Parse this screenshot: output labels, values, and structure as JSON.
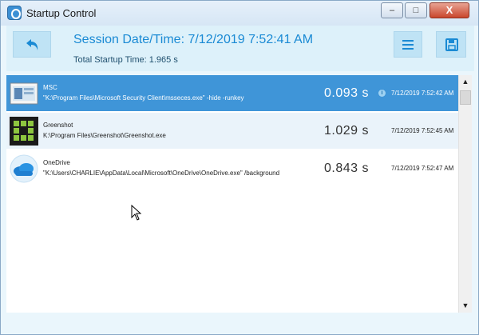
{
  "window": {
    "title": "Startup Control",
    "icon": "startup-control-app-icon",
    "controls": {
      "minimize": "–",
      "maximize": "□",
      "close": "X"
    }
  },
  "header": {
    "session_label": "Session Date/Time: 7/12/2019 7:52:41 AM",
    "total_label": "Total Startup Time: 1.965 s",
    "back_icon": "undo-arrow-icon",
    "menu_icon": "hamburger-menu-icon",
    "save_icon": "floppy-disk-icon",
    "accent_color": "#1a8ad4"
  },
  "items": [
    {
      "name": "MSC",
      "path": "\"K:\\Program Files\\Microsoft Security Client\\msseces.exe\" -hide -runkey",
      "duration": "0.093 s",
      "time": "7/12/2019 7:52:42 AM",
      "icon": "microsoft-security-client-icon",
      "selected": true,
      "has_info": true,
      "info_text": "i"
    },
    {
      "name": "Greenshot",
      "path": "K:\\Program Files\\Greenshot\\Greenshot.exe",
      "duration": "1.029 s",
      "time": "7/12/2019 7:52:45 AM",
      "icon": "greenshot-icon",
      "selected": false
    },
    {
      "name": "OneDrive",
      "path": "\"K:\\Users\\CHARLIE\\AppData\\Local\\Microsoft\\OneDrive\\OneDrive.exe\" /background",
      "duration": "0.843 s",
      "time": "7/12/2019 7:52:47 AM",
      "icon": "onedrive-cloud-icon",
      "selected": false
    }
  ],
  "scrollbar": {
    "up_arrow": "▲",
    "down_arrow": "▼"
  },
  "colors": {
    "selected_row": "#3f95d8",
    "header_bg": "#ddf1fa",
    "window_bg": "#eaf6fc"
  }
}
